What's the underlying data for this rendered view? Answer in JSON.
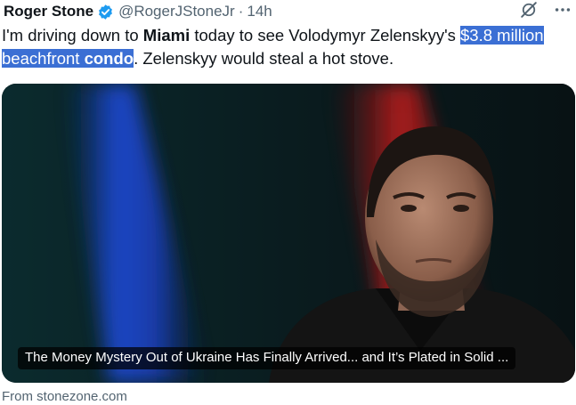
{
  "tweet": {
    "author_name": "Roger Stone",
    "handle": "@RogerJStoneJr",
    "separator": "·",
    "time": "14h",
    "text": {
      "part1": "I'm driving down to ",
      "bold1": "Miami",
      "part2": " today to see Volodymyr Zelenskyy's ",
      "highlight1": "$3.8 million beachfront ",
      "highlight_bold": "condo",
      "part3": ". Zelenskyy would steal a hot stove."
    }
  },
  "card": {
    "caption": "The Money Mystery Out of Ukraine Has Finally Arrived... and It’s Plated in Solid ...",
    "source": "From stonezone.com"
  },
  "icons": {
    "verified": "verified-badge-icon",
    "grok": "grok-icon",
    "more": "more-icon"
  },
  "colors": {
    "verified_blue": "#1d9bf0",
    "highlight": "#3b6fd4",
    "secondary_text": "#536471"
  }
}
